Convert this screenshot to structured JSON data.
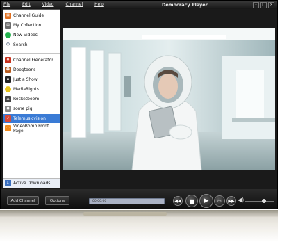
{
  "app": {
    "title": "Democracy Player"
  },
  "menu": [
    {
      "label": "File"
    },
    {
      "label": "Edit"
    },
    {
      "label": "Video"
    },
    {
      "label": "Channel"
    },
    {
      "label": "Help"
    }
  ],
  "sidebar": {
    "top_items": [
      {
        "label": "Channel Guide",
        "icon": "channel-guide-icon",
        "color": "#e07020"
      },
      {
        "label": "My Collection",
        "icon": "collection-icon",
        "color": "#6b6b6b"
      },
      {
        "label": "New Videos",
        "icon": "new-videos-icon",
        "color": "#22b14c"
      },
      {
        "label": "Search",
        "icon": "search-icon",
        "color": "#7a8aa0"
      }
    ],
    "channels": [
      {
        "label": "Channel Frederator",
        "icon": "channel-frederator-icon",
        "color": "#c8321e",
        "selected": false
      },
      {
        "label": "Doogtoons",
        "icon": "doogtoons-icon",
        "color": "#b85c1f",
        "selected": false
      },
      {
        "label": "Just a Show",
        "icon": "just-a-show-icon",
        "color": "#222222",
        "selected": false
      },
      {
        "label": "MediaRights",
        "icon": "mediarights-icon",
        "color": "#e7c21b",
        "selected": false
      },
      {
        "label": "Rocketboom",
        "icon": "rocketboom-icon",
        "color": "#444444",
        "selected": false
      },
      {
        "label": "some pig",
        "icon": "some-pig-icon",
        "color": "#888888",
        "selected": false
      },
      {
        "label": "Telemusicvision",
        "icon": "telemusicvision-icon",
        "color": "#d94a3a",
        "selected": true
      },
      {
        "label": "VideoBomb Front Page",
        "icon": "rss-feed-icon",
        "color": "#f08a1c",
        "selected": false
      }
    ],
    "downloads_label": "Active Downloads"
  },
  "controls": {
    "add_channel_label": "Add Channel",
    "options_label": "Options",
    "time": "00:00:00",
    "progress": 0.0
  },
  "colors": {
    "selection": "#3a7bd5",
    "background": "#1a1a1a"
  }
}
